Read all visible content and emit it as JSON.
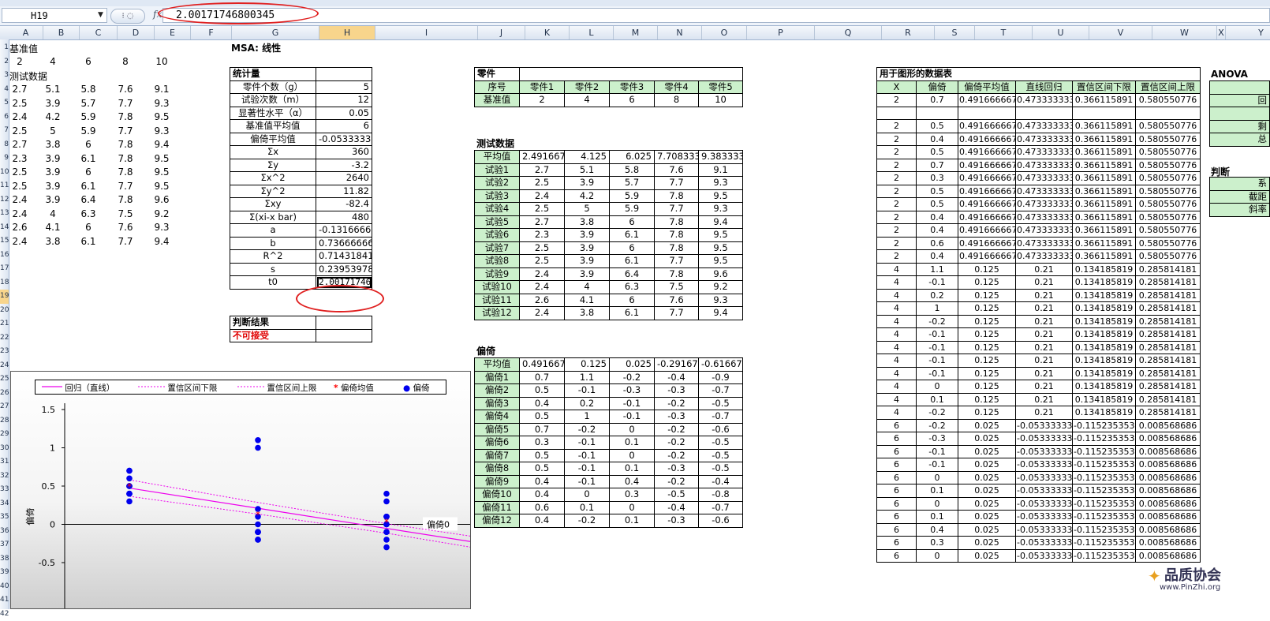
{
  "formula_bar": {
    "name_box": "H19",
    "fx": "fx",
    "value": "2.00171746800345"
  },
  "columns": [
    "A",
    "B",
    "C",
    "D",
    "E",
    "F",
    "G",
    "H",
    "I",
    "J",
    "K",
    "L",
    "M",
    "N",
    "O",
    "P",
    "Q",
    "R",
    "S",
    "T",
    "U",
    "V",
    "W",
    "X",
    "Y"
  ],
  "rows": [
    "1",
    "2",
    "3",
    "4",
    "5",
    "6",
    "7",
    "8",
    "9",
    "10",
    "11",
    "12",
    "13",
    "14",
    "15",
    "16",
    "17",
    "18",
    "19",
    "20",
    "21",
    "22",
    "23",
    "24",
    "25",
    "26",
    "27",
    "28",
    "29",
    "30",
    "31",
    "32",
    "33",
    "34",
    "35",
    "36",
    "37",
    "38",
    "39",
    "40",
    "41",
    "42"
  ],
  "left_block": {
    "ref_label": "基准值",
    "ref_values": [
      "2",
      "4",
      "6",
      "8",
      "10"
    ],
    "test_label": "测试数据",
    "test_rows": [
      [
        "2.7",
        "5.1",
        "5.8",
        "7.6",
        "9.1"
      ],
      [
        "2.5",
        "3.9",
        "5.7",
        "7.7",
        "9.3"
      ],
      [
        "2.4",
        "4.2",
        "5.9",
        "7.8",
        "9.5"
      ],
      [
        "2.5",
        "5",
        "5.9",
        "7.7",
        "9.3"
      ],
      [
        "2.7",
        "3.8",
        "6",
        "7.8",
        "9.4"
      ],
      [
        "2.3",
        "3.9",
        "6.1",
        "7.8",
        "9.5"
      ],
      [
        "2.5",
        "3.9",
        "6",
        "7.8",
        "9.5"
      ],
      [
        "2.5",
        "3.9",
        "6.1",
        "7.7",
        "9.5"
      ],
      [
        "2.4",
        "3.9",
        "6.4",
        "7.8",
        "9.6"
      ],
      [
        "2.4",
        "4",
        "6.3",
        "7.5",
        "9.2"
      ],
      [
        "2.6",
        "4.1",
        "6",
        "7.6",
        "9.3"
      ],
      [
        "2.4",
        "3.8",
        "6.1",
        "7.7",
        "9.4"
      ]
    ]
  },
  "msa_title": "MSA: 线性",
  "stats": {
    "header": "统计量",
    "rows": [
      [
        "零件个数（g）",
        "5"
      ],
      [
        "试验次数（m）",
        "12"
      ],
      [
        "显著性水平（α）",
        "0.05"
      ],
      [
        "基准值平均值",
        "6"
      ],
      [
        "偏倚平均值",
        "-0.05333333"
      ],
      [
        "Σx",
        "360"
      ],
      [
        "Σy",
        "-3.2"
      ],
      [
        "Σx^2",
        "2640"
      ],
      [
        "Σy^2",
        "11.82"
      ],
      [
        "Σxy",
        "-82.4"
      ],
      [
        "Σ(xi-x bar)",
        "480"
      ],
      [
        "a",
        "-0.13166667"
      ],
      [
        "b",
        "0.736666667"
      ],
      [
        "R^2",
        "0.714318416"
      ],
      [
        "s",
        "0.239539789"
      ],
      [
        "t0",
        "2.001717468"
      ]
    ]
  },
  "judgement": {
    "header": "判断结果",
    "result": "不可接受"
  },
  "parts": {
    "title": "零件",
    "header_row": [
      "序号",
      "零件1",
      "零件2",
      "零件3",
      "零件4",
      "零件5"
    ],
    "ref_row": [
      "基准值",
      "2",
      "4",
      "6",
      "8",
      "10"
    ]
  },
  "test_data": {
    "title": "测试数据",
    "avg_row": [
      "平均值",
      "2.491667",
      "4.125",
      "6.025",
      "7.708333",
      "9.383333"
    ],
    "rows": [
      [
        "试验1",
        "2.7",
        "5.1",
        "5.8",
        "7.6",
        "9.1"
      ],
      [
        "试验2",
        "2.5",
        "3.9",
        "5.7",
        "7.7",
        "9.3"
      ],
      [
        "试验3",
        "2.4",
        "4.2",
        "5.9",
        "7.8",
        "9.5"
      ],
      [
        "试验4",
        "2.5",
        "5",
        "5.9",
        "7.7",
        "9.3"
      ],
      [
        "试验5",
        "2.7",
        "3.8",
        "6",
        "7.8",
        "9.4"
      ],
      [
        "试验6",
        "2.3",
        "3.9",
        "6.1",
        "7.8",
        "9.5"
      ],
      [
        "试验7",
        "2.5",
        "3.9",
        "6",
        "7.8",
        "9.5"
      ],
      [
        "试验8",
        "2.5",
        "3.9",
        "6.1",
        "7.7",
        "9.5"
      ],
      [
        "试验9",
        "2.4",
        "3.9",
        "6.4",
        "7.8",
        "9.6"
      ],
      [
        "试验10",
        "2.4",
        "4",
        "6.3",
        "7.5",
        "9.2"
      ],
      [
        "试验11",
        "2.6",
        "4.1",
        "6",
        "7.6",
        "9.3"
      ],
      [
        "试验12",
        "2.4",
        "3.8",
        "6.1",
        "7.7",
        "9.4"
      ]
    ]
  },
  "bias": {
    "title": "偏倚",
    "avg_row": [
      "平均值",
      "0.491667",
      "0.125",
      "0.025",
      "-0.29167",
      "-0.61667"
    ],
    "rows": [
      [
        "偏倚1",
        "0.7",
        "1.1",
        "-0.2",
        "-0.4",
        "-0.9"
      ],
      [
        "偏倚2",
        "0.5",
        "-0.1",
        "-0.3",
        "-0.3",
        "-0.7"
      ],
      [
        "偏倚3",
        "0.4",
        "0.2",
        "-0.1",
        "-0.2",
        "-0.5"
      ],
      [
        "偏倚4",
        "0.5",
        "1",
        "-0.1",
        "-0.3",
        "-0.7"
      ],
      [
        "偏倚5",
        "0.7",
        "-0.2",
        "0",
        "-0.2",
        "-0.6"
      ],
      [
        "偏倚6",
        "0.3",
        "-0.1",
        "0.1",
        "-0.2",
        "-0.5"
      ],
      [
        "偏倚7",
        "0.5",
        "-0.1",
        "0",
        "-0.2",
        "-0.5"
      ],
      [
        "偏倚8",
        "0.5",
        "-0.1",
        "0.1",
        "-0.3",
        "-0.5"
      ],
      [
        "偏倚9",
        "0.4",
        "-0.1",
        "0.4",
        "-0.2",
        "-0.4"
      ],
      [
        "偏倚10",
        "0.4",
        "0",
        "0.3",
        "-0.5",
        "-0.8"
      ],
      [
        "偏倚11",
        "0.6",
        "0.1",
        "0",
        "-0.4",
        "-0.7"
      ],
      [
        "偏倚12",
        "0.4",
        "-0.2",
        "0.1",
        "-0.3",
        "-0.6"
      ]
    ]
  },
  "graph_table": {
    "title": "用于图形的数据表",
    "headers": [
      "X",
      "偏倚",
      "偏倚平均值",
      "直线回归",
      "置信区间下限",
      "置信区间上限"
    ],
    "rows": [
      [
        "2",
        "0.7",
        "0.491666667",
        "0.473333333",
        "0.366115891",
        "0.580550776"
      ],
      [
        "",
        "",
        "",
        "",
        "",
        ""
      ],
      [
        "2",
        "0.5",
        "0.491666667",
        "0.473333333",
        "0.366115891",
        "0.580550776"
      ],
      [
        "2",
        "0.4",
        "0.491666667",
        "0.473333333",
        "0.366115891",
        "0.580550776"
      ],
      [
        "2",
        "0.5",
        "0.491666667",
        "0.473333333",
        "0.366115891",
        "0.580550776"
      ],
      [
        "2",
        "0.7",
        "0.491666667",
        "0.473333333",
        "0.366115891",
        "0.580550776"
      ],
      [
        "2",
        "0.3",
        "0.491666667",
        "0.473333333",
        "0.366115891",
        "0.580550776"
      ],
      [
        "2",
        "0.5",
        "0.491666667",
        "0.473333333",
        "0.366115891",
        "0.580550776"
      ],
      [
        "2",
        "0.5",
        "0.491666667",
        "0.473333333",
        "0.366115891",
        "0.580550776"
      ],
      [
        "2",
        "0.4",
        "0.491666667",
        "0.473333333",
        "0.366115891",
        "0.580550776"
      ],
      [
        "2",
        "0.4",
        "0.491666667",
        "0.473333333",
        "0.366115891",
        "0.580550776"
      ],
      [
        "2",
        "0.6",
        "0.491666667",
        "0.473333333",
        "0.366115891",
        "0.580550776"
      ],
      [
        "2",
        "0.4",
        "0.491666667",
        "0.473333333",
        "0.366115891",
        "0.580550776"
      ],
      [
        "4",
        "1.1",
        "0.125",
        "0.21",
        "0.134185819",
        "0.285814181"
      ],
      [
        "4",
        "-0.1",
        "0.125",
        "0.21",
        "0.134185819",
        "0.285814181"
      ],
      [
        "4",
        "0.2",
        "0.125",
        "0.21",
        "0.134185819",
        "0.285814181"
      ],
      [
        "4",
        "1",
        "0.125",
        "0.21",
        "0.134185819",
        "0.285814181"
      ],
      [
        "4",
        "-0.2",
        "0.125",
        "0.21",
        "0.134185819",
        "0.285814181"
      ],
      [
        "4",
        "-0.1",
        "0.125",
        "0.21",
        "0.134185819",
        "0.285814181"
      ],
      [
        "4",
        "-0.1",
        "0.125",
        "0.21",
        "0.134185819",
        "0.285814181"
      ],
      [
        "4",
        "-0.1",
        "0.125",
        "0.21",
        "0.134185819",
        "0.285814181"
      ],
      [
        "4",
        "-0.1",
        "0.125",
        "0.21",
        "0.134185819",
        "0.285814181"
      ],
      [
        "4",
        "0",
        "0.125",
        "0.21",
        "0.134185819",
        "0.285814181"
      ],
      [
        "4",
        "0.1",
        "0.125",
        "0.21",
        "0.134185819",
        "0.285814181"
      ],
      [
        "4",
        "-0.2",
        "0.125",
        "0.21",
        "0.134185819",
        "0.285814181"
      ],
      [
        "6",
        "-0.2",
        "0.025",
        "-0.05333333",
        "-0.115235353",
        "0.008568686"
      ],
      [
        "6",
        "-0.3",
        "0.025",
        "-0.05333333",
        "-0.115235353",
        "0.008568686"
      ],
      [
        "6",
        "-0.1",
        "0.025",
        "-0.05333333",
        "-0.115235353",
        "0.008568686"
      ],
      [
        "6",
        "-0.1",
        "0.025",
        "-0.05333333",
        "-0.115235353",
        "0.008568686"
      ],
      [
        "6",
        "0",
        "0.025",
        "-0.05333333",
        "-0.115235353",
        "0.008568686"
      ],
      [
        "6",
        "0.1",
        "0.025",
        "-0.05333333",
        "-0.115235353",
        "0.008568686"
      ],
      [
        "6",
        "0",
        "0.025",
        "-0.05333333",
        "-0.115235353",
        "0.008568686"
      ],
      [
        "6",
        "0.1",
        "0.025",
        "-0.05333333",
        "-0.115235353",
        "0.008568686"
      ],
      [
        "6",
        "0.4",
        "0.025",
        "-0.05333333",
        "-0.115235353",
        "0.008568686"
      ],
      [
        "6",
        "0.3",
        "0.025",
        "-0.05333333",
        "-0.115235353",
        "0.008568686"
      ],
      [
        "6",
        "0",
        "0.025",
        "-0.05333333",
        "-0.115235353",
        "0.008568686"
      ]
    ]
  },
  "anova_partial": {
    "title": "ANOVA",
    "cells": [
      "",
      "回",
      "",
      "剩",
      "总"
    ],
    "judge_title": "判断",
    "judge_cells": [
      "系",
      "截距",
      "斜率"
    ]
  },
  "watermark": "品质协会",
  "watermark_url": "www.PinZhi.org",
  "chart_data": {
    "type": "scatter",
    "title": "",
    "xlabel": "",
    "ylabel": "偏倚",
    "zero_line_label": "偏倚0",
    "yticks": [
      "1.5",
      "1",
      "0.5",
      "0",
      "-0.5"
    ],
    "xlim": [
      1,
      11
    ],
    "ylim": [
      -1,
      1.5
    ],
    "legend": [
      "回归（直线）",
      "置信区间下限",
      "置信区间上限",
      "偏倚均值",
      "偏倚"
    ],
    "legend_position": "top",
    "colors": {
      "bias": "#0000ee",
      "regression": "#ee00ee",
      "mean": "#ff0000"
    },
    "points": {
      "x": [
        2,
        2,
        2,
        2,
        2,
        2,
        2,
        2,
        2,
        2,
        2,
        2,
        4,
        4,
        4,
        4,
        4,
        4,
        4,
        4,
        4,
        4,
        4,
        4,
        6,
        6,
        6,
        6,
        6,
        6,
        6,
        6,
        6,
        6,
        6,
        6,
        8,
        8,
        8,
        8,
        8,
        8,
        8,
        8,
        8,
        8,
        8,
        8,
        10,
        10,
        10,
        10,
        10,
        10,
        10,
        10,
        10,
        10,
        10,
        10
      ],
      "y": [
        0.7,
        0.5,
        0.4,
        0.5,
        0.7,
        0.3,
        0.5,
        0.5,
        0.4,
        0.4,
        0.6,
        0.4,
        1.1,
        -0.1,
        0.2,
        1,
        -0.2,
        -0.1,
        -0.1,
        -0.1,
        -0.1,
        0,
        0.1,
        -0.2,
        -0.2,
        -0.3,
        -0.1,
        -0.1,
        0,
        0.1,
        0,
        0.1,
        0.4,
        0.3,
        0,
        0.1,
        -0.4,
        -0.3,
        -0.2,
        -0.3,
        -0.2,
        -0.2,
        -0.2,
        -0.3,
        -0.2,
        -0.5,
        -0.4,
        -0.3,
        -0.9,
        -0.7,
        -0.5,
        -0.7,
        -0.6,
        -0.5,
        -0.5,
        -0.5,
        -0.4,
        -0.8,
        -0.7,
        -0.6
      ]
    },
    "regression": {
      "x": [
        2,
        4,
        6,
        8,
        10
      ],
      "y": [
        0.473333333,
        0.21,
        -0.05333333,
        -0.31666667,
        -0.58
      ]
    },
    "ci_lower": {
      "x": [
        2,
        4,
        6,
        8,
        10
      ],
      "y": [
        0.366115891,
        0.134185819,
        -0.115235353,
        -0.395,
        -0.7
      ]
    },
    "ci_upper": {
      "x": [
        2,
        4,
        6,
        8,
        10
      ],
      "y": [
        0.580550776,
        0.285814181,
        0.008568686,
        -0.24,
        -0.46
      ]
    },
    "means": {
      "x": [
        2,
        4,
        6,
        8,
        10
      ],
      "y": [
        0.491667,
        0.125,
        0.025,
        -0.29167,
        -0.61667
      ]
    }
  }
}
